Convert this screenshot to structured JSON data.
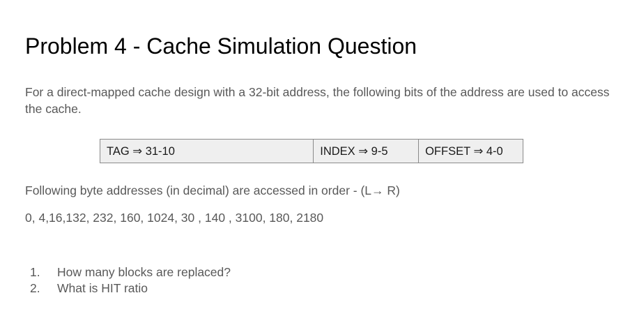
{
  "title": "Problem 4 - Cache Simulation Question",
  "intro": "For a direct-mapped cache design with a 32-bit address, the following bits of the address are used to access the cache.",
  "address_fields": [
    {
      "label": "TAG ⇒  31-10"
    },
    {
      "label": "INDEX ⇒  9-5"
    },
    {
      "label": "OFFSET ⇒  4-0"
    }
  ],
  "order_text": "Following byte addresses (in decimal) are accessed in order - (L→ R)",
  "addresses_text": "0, 4,16,132, 232, 160, 1024, 30 , 140 , 3100, 180, 2180",
  "questions": [
    {
      "number": "1.",
      "text": "How many blocks are replaced?"
    },
    {
      "number": "2.",
      "text": "What is HIT ratio"
    }
  ]
}
